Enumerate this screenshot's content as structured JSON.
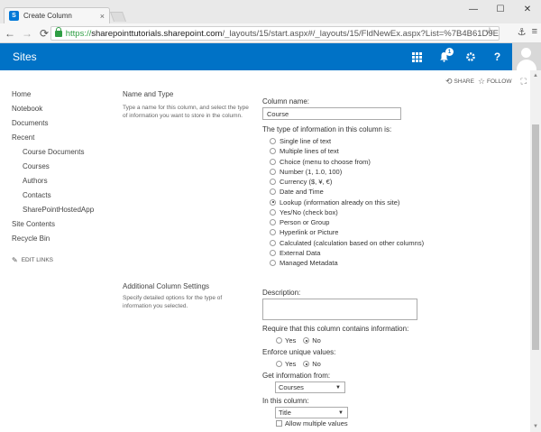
{
  "browser": {
    "tab_title": "Create Column",
    "tab_close": "×",
    "window_buttons": [
      "—",
      "☐",
      "✕"
    ],
    "url_scheme": "https://",
    "url_host": "sharepointtutorials.sharepoint.com",
    "url_path": "/_layouts/15/start.aspx#/_layouts/15/FldNewEx.aspx?List=%7B4B61D9E",
    "nav": {
      "back": "←",
      "forward": "→",
      "reload": "⟳"
    }
  },
  "suitebar": {
    "brand": "Sites",
    "notification_count": "1",
    "help_label": "?"
  },
  "actions": {
    "share": "SHARE",
    "follow": "FOLLOW"
  },
  "leftnav": {
    "items": [
      {
        "label": "Home",
        "sub": false
      },
      {
        "label": "Notebook",
        "sub": false
      },
      {
        "label": "Documents",
        "sub": false
      },
      {
        "label": "Recent",
        "sub": false
      },
      {
        "label": "Course Documents",
        "sub": true
      },
      {
        "label": "Courses",
        "sub": true
      },
      {
        "label": "Authors",
        "sub": true
      },
      {
        "label": "Contacts",
        "sub": true
      },
      {
        "label": "SharePointHostedApp",
        "sub": true
      },
      {
        "label": "Site Contents",
        "sub": false
      },
      {
        "label": "Recycle Bin",
        "sub": false
      }
    ],
    "edit_links": "EDIT LINKS"
  },
  "name_type": {
    "title": "Name and Type",
    "description": "Type a name for this column, and select the type of information you want to store in the column.",
    "column_name_label": "Column name:",
    "column_name_value": "Course",
    "type_label": "The type of information in this column is:",
    "types": [
      {
        "label": "Single line of text",
        "checked": false
      },
      {
        "label": "Multiple lines of text",
        "checked": false
      },
      {
        "label": "Choice (menu to choose from)",
        "checked": false
      },
      {
        "label": "Number (1, 1.0, 100)",
        "checked": false
      },
      {
        "label": "Currency ($, ¥, €)",
        "checked": false
      },
      {
        "label": "Date and Time",
        "checked": false
      },
      {
        "label": "Lookup (information already on this site)",
        "checked": true
      },
      {
        "label": "Yes/No (check box)",
        "checked": false
      },
      {
        "label": "Person or Group",
        "checked": false
      },
      {
        "label": "Hyperlink or Picture",
        "checked": false
      },
      {
        "label": "Calculated (calculation based on other columns)",
        "checked": false
      },
      {
        "label": "External Data",
        "checked": false
      },
      {
        "label": "Managed Metadata",
        "checked": false
      }
    ]
  },
  "additional": {
    "title": "Additional Column Settings",
    "description": "Specify detailed options for the type of information you selected.",
    "description_label": "Description:",
    "require_label": "Require that this column contains information:",
    "require_yes": "Yes",
    "require_no": "No",
    "unique_label": "Enforce unique values:",
    "unique_yes": "Yes",
    "unique_no": "No",
    "get_info_label": "Get information from:",
    "get_info_value": "Courses",
    "in_column_label": "In this column:",
    "in_column_value": "Title",
    "allow_multiple": "Allow multiple values"
  }
}
